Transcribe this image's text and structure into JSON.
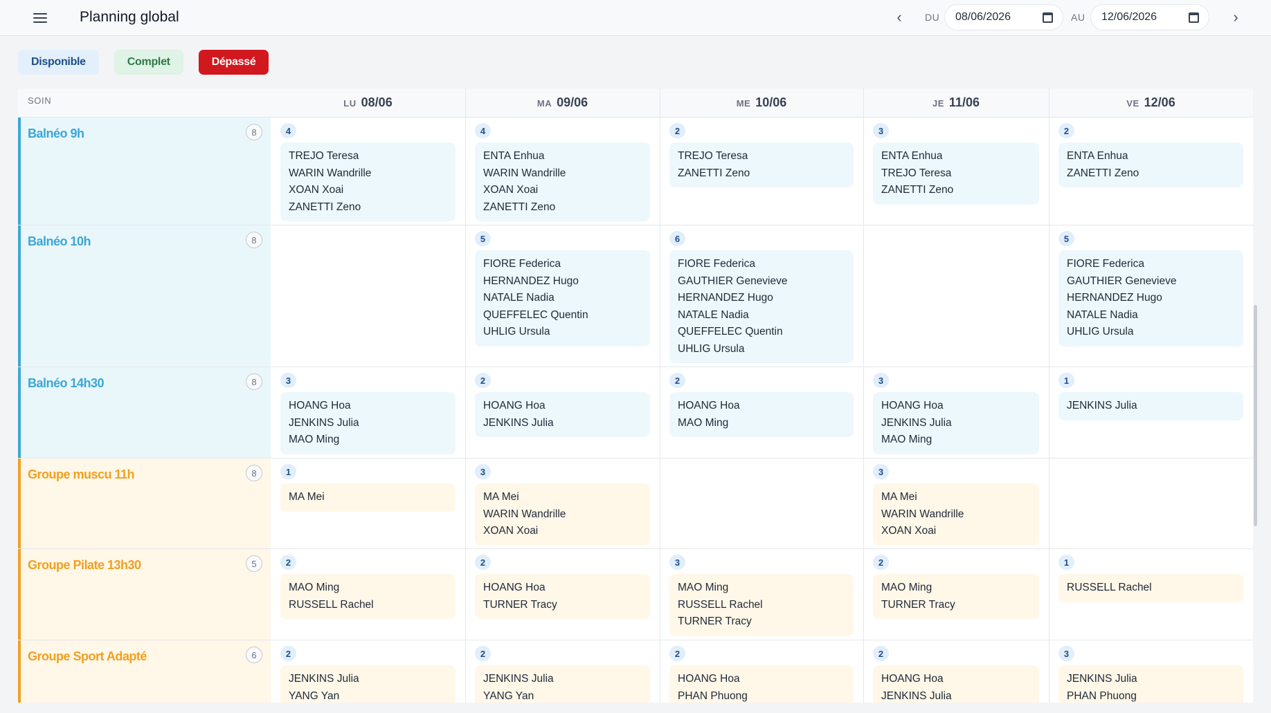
{
  "header": {
    "title": "Planning global",
    "from_label": "DU",
    "to_label": "AU",
    "from_date": "08/06/2026",
    "to_date": "12/06/2026"
  },
  "legend": {
    "available": "Disponible",
    "complete": "Complet",
    "exceeded": "Dépassé"
  },
  "colors": {
    "blue_accent": "#3ea7d4",
    "orange_accent": "#f0a024",
    "exceeded_red": "#d1181e"
  },
  "table": {
    "soin_header": "SOIN",
    "days": [
      {
        "dow": "LU",
        "date": "08/06"
      },
      {
        "dow": "MA",
        "date": "09/06"
      },
      {
        "dow": "ME",
        "date": "10/06"
      },
      {
        "dow": "JE",
        "date": "11/06"
      },
      {
        "dow": "VE",
        "date": "12/06"
      }
    ],
    "rows": [
      {
        "name": "Balnéo 9h",
        "capacity": "8",
        "tone": "blue",
        "cells": [
          {
            "count": "4",
            "patients": [
              "TREJO Teresa",
              "WARIN Wandrille",
              "XOAN Xoai",
              "ZANETTI Zeno"
            ]
          },
          {
            "count": "4",
            "patients": [
              "ENTA Enhua",
              "WARIN Wandrille",
              "XOAN Xoai",
              "ZANETTI Zeno"
            ]
          },
          {
            "count": "2",
            "patients": [
              "TREJO Teresa",
              "ZANETTI Zeno"
            ]
          },
          {
            "count": "3",
            "patients": [
              "ENTA Enhua",
              "TREJO Teresa",
              "ZANETTI Zeno"
            ]
          },
          {
            "count": "2",
            "patients": [
              "ENTA Enhua",
              "ZANETTI Zeno"
            ]
          }
        ]
      },
      {
        "name": "Balnéo 10h",
        "capacity": "8",
        "tone": "blue",
        "cells": [
          null,
          {
            "count": "5",
            "patients": [
              "FIORE Federica",
              "HERNANDEZ Hugo",
              "NATALE Nadia",
              "QUEFFELEC Quentin",
              "UHLIG Ursula"
            ]
          },
          {
            "count": "6",
            "patients": [
              "FIORE Federica",
              "GAUTHIER Genevieve",
              "HERNANDEZ Hugo",
              "NATALE Nadia",
              "QUEFFELEC Quentin",
              "UHLIG Ursula"
            ]
          },
          null,
          {
            "count": "5",
            "patients": [
              "FIORE Federica",
              "GAUTHIER Genevieve",
              "HERNANDEZ Hugo",
              "NATALE Nadia",
              "UHLIG Ursula"
            ]
          }
        ]
      },
      {
        "name": "Balnéo 14h30",
        "capacity": "8",
        "tone": "blue",
        "cells": [
          {
            "count": "3",
            "patients": [
              "HOANG Hoa",
              "JENKINS Julia",
              "MAO Ming"
            ]
          },
          {
            "count": "2",
            "patients": [
              "HOANG Hoa",
              "JENKINS Julia"
            ]
          },
          {
            "count": "2",
            "patients": [
              "HOANG Hoa",
              "MAO Ming"
            ]
          },
          {
            "count": "3",
            "patients": [
              "HOANG Hoa",
              "JENKINS Julia",
              "MAO Ming"
            ]
          },
          {
            "count": "1",
            "patients": [
              "JENKINS Julia"
            ]
          }
        ]
      },
      {
        "name": "Groupe muscu 11h",
        "capacity": "8",
        "tone": "orange",
        "cells": [
          {
            "count": "1",
            "patients": [
              "MA Mei"
            ]
          },
          {
            "count": "3",
            "patients": [
              "MA Mei",
              "WARIN Wandrille",
              "XOAN Xoai"
            ]
          },
          null,
          {
            "count": "3",
            "patients": [
              "MA Mei",
              "WARIN Wandrille",
              "XOAN Xoai"
            ]
          },
          null
        ]
      },
      {
        "name": "Groupe Pilate 13h30",
        "capacity": "5",
        "tone": "orange",
        "cells": [
          {
            "count": "2",
            "patients": [
              "MAO Ming",
              "RUSSELL Rachel"
            ]
          },
          {
            "count": "2",
            "patients": [
              "HOANG Hoa",
              "TURNER Tracy"
            ]
          },
          {
            "count": "3",
            "patients": [
              "MAO Ming",
              "RUSSELL Rachel",
              "TURNER Tracy"
            ]
          },
          {
            "count": "2",
            "patients": [
              "MAO Ming",
              "TURNER Tracy"
            ]
          },
          {
            "count": "1",
            "patients": [
              "RUSSELL Rachel"
            ]
          }
        ]
      },
      {
        "name": "Groupe Sport Adapté",
        "capacity": "6",
        "tone": "orange",
        "cells": [
          {
            "count": "2",
            "patients": [
              "JENKINS Julia",
              "YANG Yan"
            ]
          },
          {
            "count": "2",
            "patients": [
              "JENKINS Julia",
              "YANG Yan"
            ]
          },
          {
            "count": "2",
            "patients": [
              "HOANG Hoa",
              "PHAN Phuong"
            ]
          },
          {
            "count": "2",
            "patients": [
              "HOANG Hoa",
              "JENKINS Julia"
            ]
          },
          {
            "count": "3",
            "patients": [
              "JENKINS Julia",
              "PHAN Phuong"
            ]
          }
        ]
      }
    ]
  }
}
